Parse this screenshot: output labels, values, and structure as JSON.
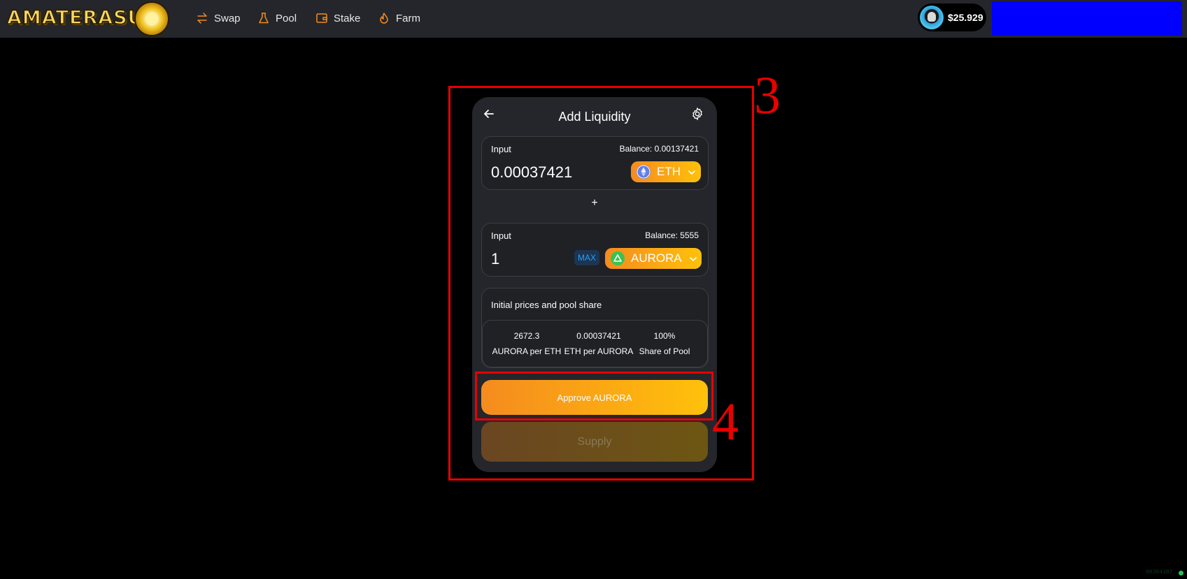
{
  "header": {
    "logo_text": "AMATERASU",
    "nav": [
      {
        "label": "Swap",
        "icon": "swap-arrows-icon"
      },
      {
        "label": "Pool",
        "icon": "beaker-icon"
      },
      {
        "label": "Stake",
        "icon": "wallet-icon"
      },
      {
        "label": "Farm",
        "icon": "flame-icon"
      }
    ],
    "wallet_balance": "$25.929",
    "accent_color": "#f58b1f"
  },
  "annotations": {
    "box3_label": "3",
    "box4_label": "4"
  },
  "card": {
    "title": "Add Liquidity",
    "input1": {
      "label": "Input",
      "balance": "Balance: 0.00137421",
      "value": "0.00037421",
      "token": "ETH"
    },
    "plus_sign": "+",
    "input2": {
      "label": "Input",
      "balance": "Balance: 5555",
      "value": "1",
      "max_label": "MAX",
      "token": "AURORA"
    },
    "prices": {
      "title": "Initial prices and pool share",
      "items": [
        {
          "value": "2672.3",
          "label": "AURORA per ETH"
        },
        {
          "value": "0.00037421",
          "label": "ETH per AURORA"
        },
        {
          "value": "100%",
          "label": "Share of Pool"
        }
      ]
    },
    "approve_label": "Approve AURORA",
    "supply_label": "Supply"
  },
  "footer": {
    "corner_text": "00304387"
  }
}
